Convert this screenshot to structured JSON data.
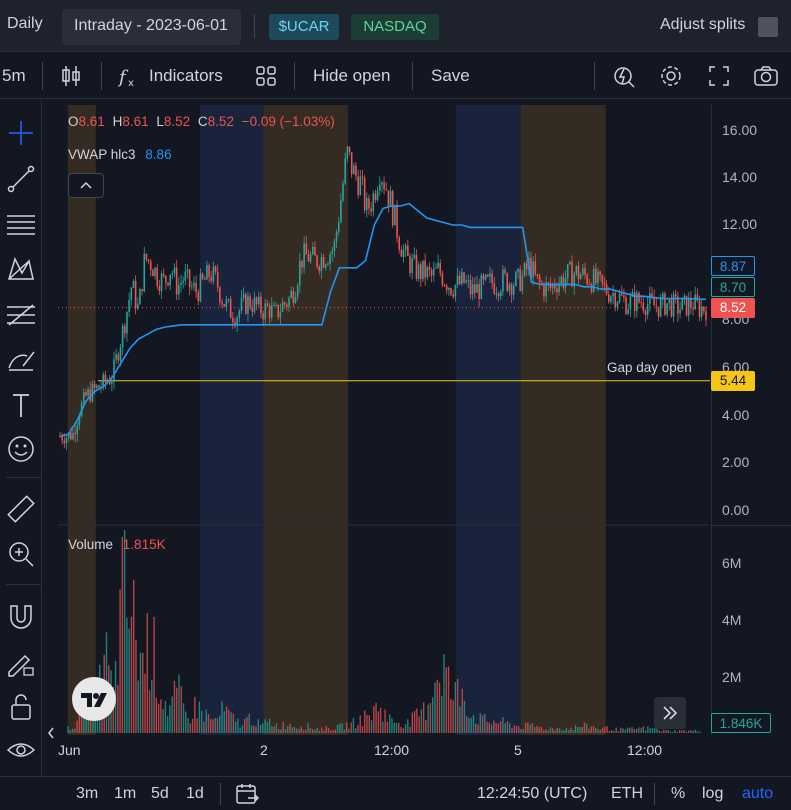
{
  "topbar": {
    "interval": "Daily",
    "mode": "Intraday",
    "date": "2023-06-01",
    "ticker": "$UCAR",
    "exchange": "NASDAQ",
    "adjust_splits": "Adjust splits"
  },
  "toolbar": {
    "timeframe": "5m",
    "indicators": "Indicators",
    "hide_open": "Hide open",
    "save": "Save"
  },
  "legend": {
    "o_label": "O",
    "o": "8.61",
    "h_label": "H",
    "h": "8.61",
    "l_label": "L",
    "l": "8.52",
    "c_label": "C",
    "c": "8.52",
    "change": "−0.09 (−1.03%)",
    "vwap_label": "VWAP hlc3",
    "vwap_value": "8.86",
    "volume_label": "Volume",
    "volume_value": "1.815K",
    "gap_label": "Gap day open"
  },
  "price_axis": {
    "ticks": [
      "16.00",
      "14.00",
      "12.00",
      "8.00",
      "6.00",
      "4.00",
      "2.00",
      "0.00"
    ],
    "tag_vwap": "8.87",
    "tag_other": "8.70",
    "tag_last": "8.52",
    "tag_gap": "5.44"
  },
  "volume_axis": {
    "ticks": [
      "6M",
      "4M",
      "2M"
    ],
    "tag_volume": "1.846K"
  },
  "time_axis": {
    "labels": [
      "Jun",
      "2",
      "12:00",
      "5",
      "12:00"
    ]
  },
  "bottombar": {
    "ranges": [
      "3m",
      "1m",
      "5d",
      "1d"
    ],
    "clock": "12:24:50 (UTC)",
    "session": "ETH",
    "percent": "%",
    "log": "log",
    "auto": "auto"
  },
  "colors": {
    "up": "#26a69a",
    "down": "#ef5350",
    "vwap": "#2196f3",
    "gap": "#f5c518",
    "premarket": "#3b2f22",
    "regular": "#1b2640"
  },
  "chart_data": {
    "type": "candlestick",
    "title": "$UCAR 5m",
    "ylim": [
      0,
      17
    ],
    "last_close": 8.52,
    "gap_day_open": 5.44,
    "vwap_last": 8.87,
    "price_path": [
      3.1,
      3.1,
      3.2,
      4.2,
      4.8,
      5.0,
      5.2,
      5.4,
      5.6,
      6.8,
      8.0,
      9.5,
      8.4,
      10.6,
      10.4,
      9.8,
      9.6,
      10.2,
      9.4,
      9.8,
      9.4,
      9.2,
      9.6,
      10.0,
      9.6,
      8.8,
      8.4,
      8.2,
      8.6,
      8.8,
      8.6,
      8.4,
      8.5,
      8.2,
      8.6,
      8.8,
      9.4,
      10.6,
      10.7,
      10.5,
      10.6,
      10.8,
      11.0,
      13.0,
      15.0,
      14.2,
      13.8,
      12.6,
      13.2,
      14.4,
      13.6,
      12.6,
      11.4,
      10.6,
      10.3,
      10.0,
      10.0,
      9.8,
      10.1,
      9.7,
      9.4,
      9.5,
      9.6,
      9.2,
      9.3,
      9.4,
      9.6,
      9.5,
      9.7,
      9.6,
      9.6,
      9.8,
      10.4,
      9.6,
      9.4,
      9.3,
      9.6,
      9.7,
      9.9,
      10.0,
      9.9,
      9.8,
      9.6,
      9.4,
      9.2,
      9.1,
      8.9,
      8.7,
      8.8,
      8.8,
      8.7,
      8.6,
      8.6,
      8.7,
      8.6,
      8.5,
      8.6,
      8.7,
      8.5,
      8.52
    ],
    "vwap_path": [
      3.1,
      3.2,
      3.8,
      4.6,
      5.0,
      5.2,
      5.6,
      6.2,
      6.8,
      7.2,
      7.4,
      7.6,
      7.7,
      7.75,
      7.8,
      7.8,
      7.8,
      7.8,
      7.8,
      7.8,
      7.8,
      7.8,
      7.8,
      7.8,
      7.8,
      7.8,
      7.8,
      7.8,
      7.8,
      7.8,
      7.8,
      9.2,
      10.2,
      10.2,
      10.2,
      10.5,
      12.0,
      12.7,
      12.8,
      12.8,
      12.9,
      12.6,
      12.3,
      12.2,
      12.1,
      12.0,
      12.0,
      11.9,
      11.9,
      11.9,
      11.9,
      11.9,
      11.9,
      11.9,
      9.6,
      9.5,
      9.5,
      9.5,
      9.5,
      9.5,
      9.4,
      9.4,
      9.3,
      9.3,
      9.2,
      9.1,
      9.0,
      9.0,
      8.95,
      8.9,
      8.9,
      8.9,
      8.9,
      8.88,
      8.87
    ],
    "volume_ylim": [
      0,
      7
    ],
    "volume_unit": "M",
    "volume_path": [
      0.2,
      0.4,
      2.0,
      0.8,
      3.5,
      1.5,
      6.2,
      5.0,
      3.0,
      4.2,
      2.0,
      1.0,
      1.8,
      0.6,
      1.2,
      0.8,
      0.5,
      1.0,
      0.6,
      0.4,
      0.7,
      0.3,
      0.5,
      0.3,
      0.4,
      0.3,
      0.3,
      0.2,
      0.2,
      0.2,
      0.3,
      0.4,
      0.6,
      0.8,
      1.2,
      0.6,
      0.5,
      0.4,
      0.7,
      1.0,
      2.4,
      3.0,
      1.5,
      2.0,
      0.8,
      0.6,
      0.5,
      0.5,
      0.4,
      0.3,
      0.3,
      0.3,
      0.2,
      0.2,
      0.2,
      0.2,
      0.3,
      0.3,
      0.2,
      0.2,
      0.15,
      0.15,
      0.2,
      0.2,
      0.2,
      0.1,
      0.1,
      0.1,
      0.1,
      0.1
    ]
  }
}
